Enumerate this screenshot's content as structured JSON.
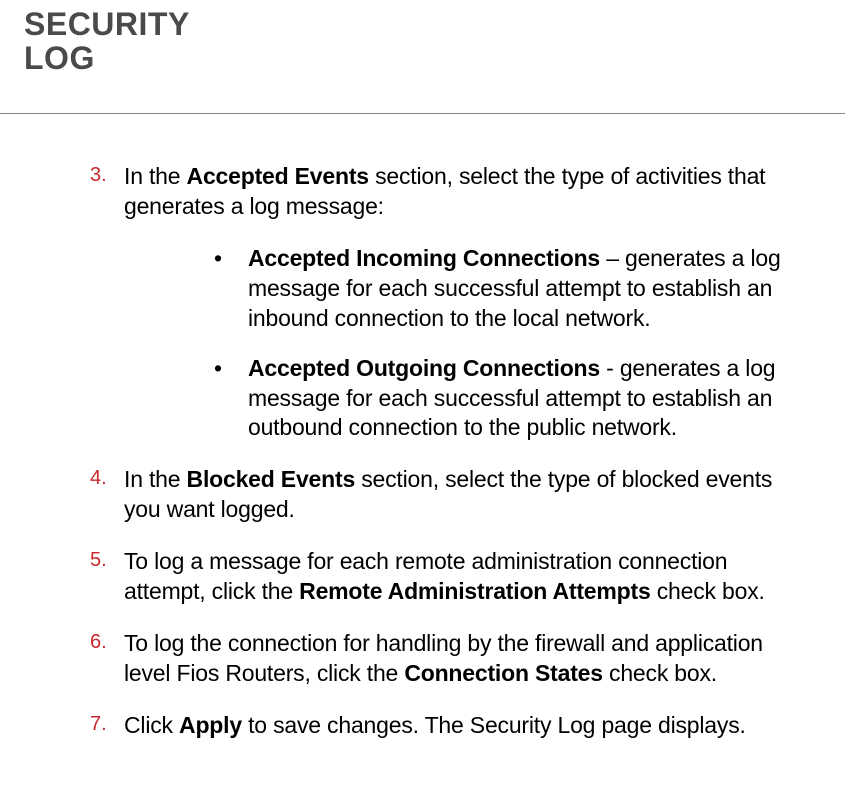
{
  "header": {
    "title_line1": "SECURITY",
    "title_line2": "LOG"
  },
  "steps": {
    "step3": {
      "num": "3.",
      "pre": "In the ",
      "bold1": "Accepted Events",
      "post": " section, select the type of activities that generates a log message:"
    },
    "bullets": {
      "b1": {
        "bold": "Accepted Incoming Connections",
        "rest": " – generates a log message for each successful attempt to establish an inbound connection to the local network."
      },
      "b2": {
        "bold": "Accepted Outgoing Connections",
        "rest": " - generates a log message for each successful attempt to establish an outbound connection to the public network."
      }
    },
    "step4": {
      "num": "4.",
      "pre": "In the ",
      "bold1": "Blocked Events",
      "post": " section, select the type of blocked events you want logged."
    },
    "step5": {
      "num": "5.",
      "pre": "To log a message for each remote administration connection attempt, click the ",
      "bold1": "Remote Administration Attempts",
      "post": " check box."
    },
    "step6": {
      "num": "6.",
      "pre": "To log the connection for handling by the firewall and application level Fios Routers, click the ",
      "bold1": "Connection States",
      "post": " check box."
    },
    "step7": {
      "num": "7.",
      "pre": "Click ",
      "bold1": "Apply",
      "post": " to save changes. The Security Log page displays."
    }
  },
  "bullet_char": "•"
}
